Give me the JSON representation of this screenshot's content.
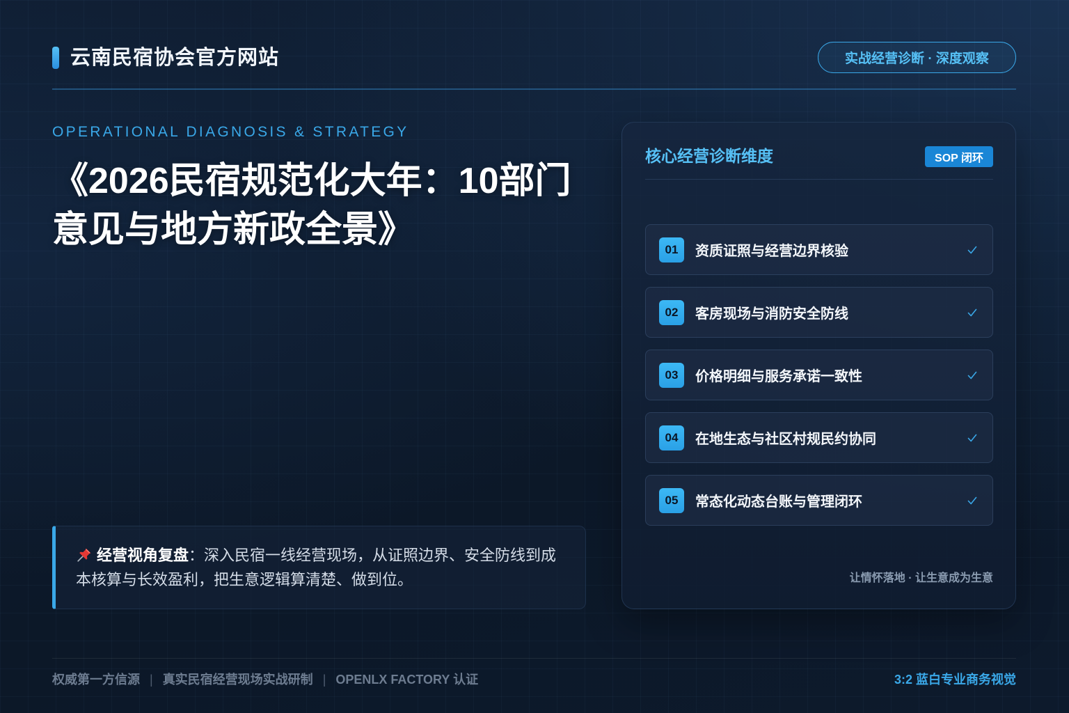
{
  "header": {
    "site_title": "云南民宿协会官方网站",
    "tag": "实战经营诊断 · 深度观察"
  },
  "hero": {
    "eyebrow": "OPERATIONAL DIAGNOSIS & STRATEGY",
    "title_lines": [
      "《2026民宿规范化大年：10部门",
      "意见与地方新政全景》"
    ]
  },
  "quote": {
    "icon": "pushpin-icon",
    "lead": "经营视角复盘",
    "body": "：深入民宿一线经营现场，从证照边界、安全防线到成本核算与长效盈利，把生意逻辑算清楚、做到位。"
  },
  "panel": {
    "title": "核心经营诊断维度",
    "badge": "SOP 闭环",
    "item_icon": "check-icon",
    "items": [
      {
        "num": "01",
        "label": "资质证照与经营边界核验"
      },
      {
        "num": "02",
        "label": "客房现场与消防安全防线"
      },
      {
        "num": "03",
        "label": "价格明细与服务承诺一致性"
      },
      {
        "num": "04",
        "label": "在地生态与社区村规民约协同"
      },
      {
        "num": "05",
        "label": "常态化动态台账与管理闭环"
      }
    ],
    "footnote": "让情怀落地 · 让生意成为生意"
  },
  "footer": {
    "credits": [
      "权威第一方信源",
      "真实民宿经营现场实战研制",
      "OPENLX FACTORY 认证"
    ],
    "separator": "|",
    "format_note": "3:2 蓝白专业商务视觉"
  },
  "colors": {
    "accent": "#3aa8e8",
    "accent_light": "#56c0f5",
    "badge": "#1a86d6",
    "number_chip": "#3cb8f5",
    "background": "#0e1a2c"
  }
}
